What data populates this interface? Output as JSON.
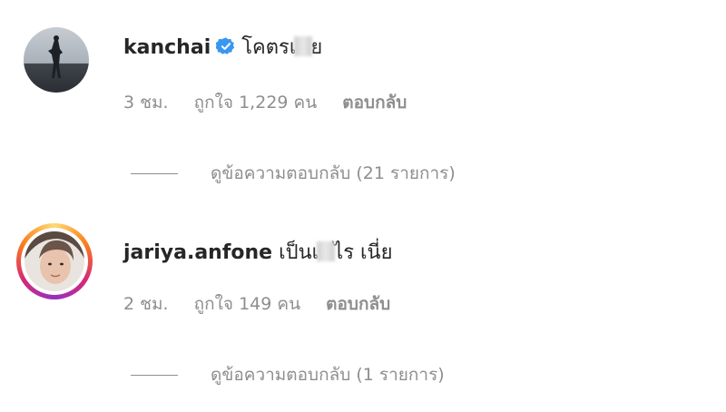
{
  "comments": [
    {
      "username": "kanchai",
      "verified": true,
      "text_before": "โคตรเ",
      "text_after": "ย",
      "time": "3 ชม.",
      "likes": "ถูกใจ 1,229 คน",
      "reply": "ตอบกลับ",
      "view_replies": "ดูข้อความตอบกลับ (21 รายการ)"
    },
    {
      "username": "jariya.anfone",
      "verified": false,
      "text_before": "เป็นเ",
      "text_after": "ไร เนี่ย",
      "time": "2 ชม.",
      "likes": "ถูกใจ 149 คน",
      "reply": "ตอบกลับ",
      "view_replies": "ดูข้อความตอบกลับ (1 รายการ)"
    }
  ],
  "colors": {
    "text": "#262626",
    "secondary": "#8e8e8e",
    "verified": "#3897f0"
  }
}
